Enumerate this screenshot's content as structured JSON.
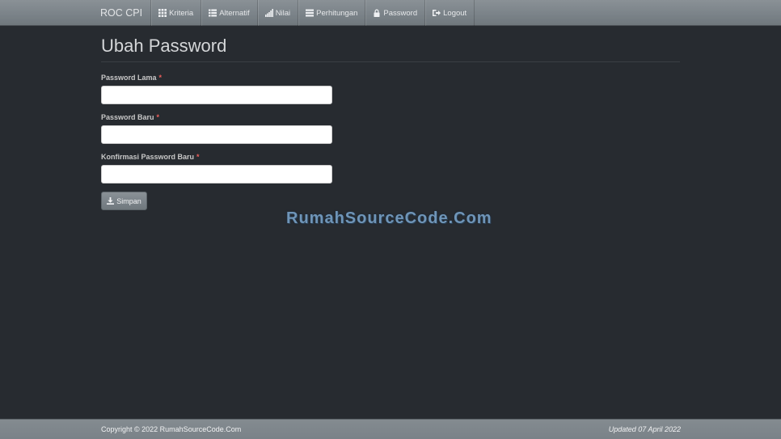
{
  "navbar": {
    "brand": "ROC CPI",
    "items": [
      {
        "label": "Kriteria",
        "icon": "grid-icon"
      },
      {
        "label": "Alternatif",
        "icon": "list-icon"
      },
      {
        "label": "Nilai",
        "icon": "signal-icon"
      },
      {
        "label": "Perhitungan",
        "icon": "calculator-icon"
      },
      {
        "label": "Password",
        "icon": "lock-icon"
      },
      {
        "label": "Logout",
        "icon": "logout-icon"
      }
    ]
  },
  "page": {
    "title": "Ubah Password"
  },
  "form": {
    "old_password": {
      "label": "Password Lama",
      "required": "*",
      "value": ""
    },
    "new_password": {
      "label": "Password Baru",
      "required": "*",
      "value": ""
    },
    "confirm_password": {
      "label": "Konfirmasi Password Baru",
      "required": "*",
      "value": ""
    },
    "save_label": "Simpan"
  },
  "watermark": "RumahSourceCode.Com",
  "footer": {
    "copyright": "Copyright © 2022 RumahSourceCode.Com",
    "updated": "Updated 07 April 2022"
  }
}
